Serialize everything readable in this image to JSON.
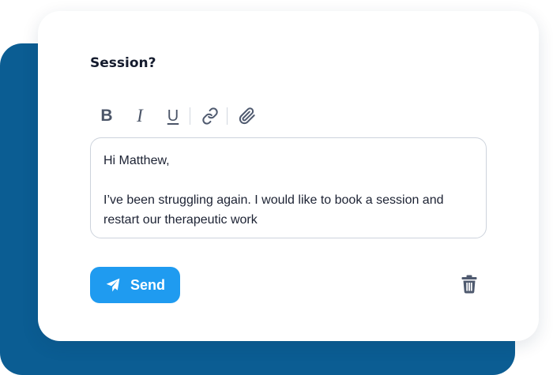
{
  "card": {
    "title": "Session?"
  },
  "toolbar": {
    "bold_label": "B",
    "italic_label": "I",
    "underline_label": "U",
    "link_icon": "link-icon",
    "attachment_icon": "paperclip-icon"
  },
  "message": {
    "greeting": "Hi Matthew,",
    "body": "I’ve been struggling again. I would like to book a session and restart our therapeutic work"
  },
  "actions": {
    "send_label": "Send",
    "send_icon": "paper-plane-icon",
    "delete_icon": "trash-icon"
  },
  "colors": {
    "backdrop": "#0b5d93",
    "send_button": "#1f9bf0",
    "title_text": "#141b2d",
    "icon": "#4f5a6f"
  }
}
